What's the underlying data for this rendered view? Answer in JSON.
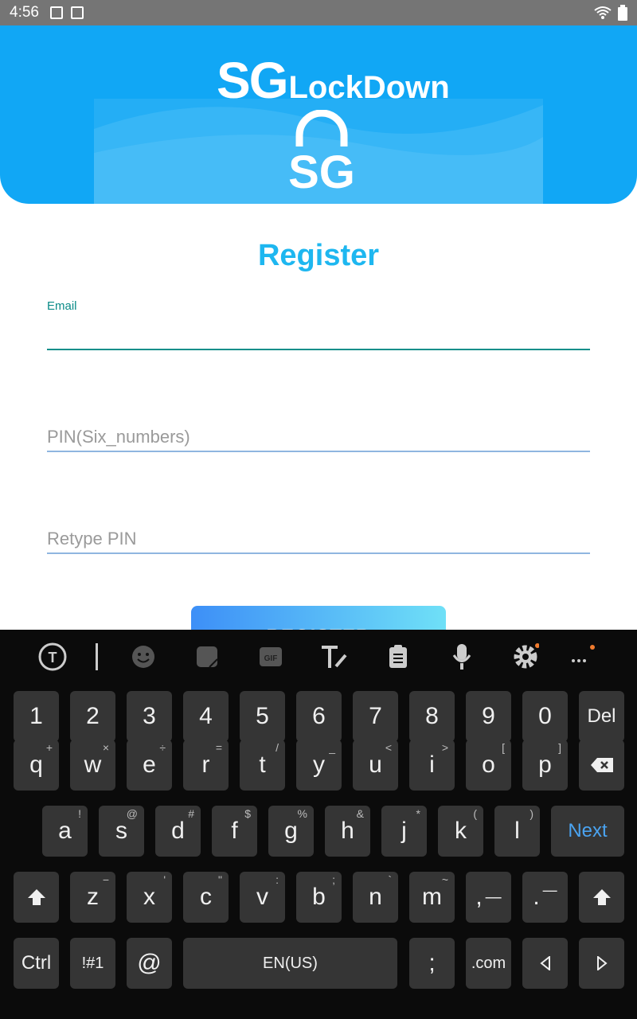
{
  "status_bar": {
    "time": "4:56"
  },
  "header": {
    "logo_sg": "SG",
    "logo_lockdown": "LockDown",
    "logo_icon_text": "SG"
  },
  "form": {
    "title": "Register",
    "email_label": "Email",
    "pin_placeholder": "PIN(Six_numbers)",
    "retype_placeholder": "Retype PIN",
    "register_label": "REGISTER"
  },
  "keyboard": {
    "row_numbers": [
      "1",
      "2",
      "3",
      "4",
      "5",
      "6",
      "7",
      "8",
      "9",
      "0"
    ],
    "del_label": "Del",
    "row_top": [
      {
        "k": "q",
        "s": "+"
      },
      {
        "k": "w",
        "s": "×"
      },
      {
        "k": "e",
        "s": "÷"
      },
      {
        "k": "r",
        "s": "="
      },
      {
        "k": "t",
        "s": "/"
      },
      {
        "k": "y",
        "s": "_"
      },
      {
        "k": "u",
        "s": "<"
      },
      {
        "k": "i",
        "s": ">"
      },
      {
        "k": "o",
        "s": "["
      },
      {
        "k": "p",
        "s": "]"
      }
    ],
    "row_mid": [
      {
        "k": "a",
        "s": "!"
      },
      {
        "k": "s",
        "s": "@"
      },
      {
        "k": "d",
        "s": "#"
      },
      {
        "k": "f",
        "s": "$"
      },
      {
        "k": "g",
        "s": "%"
      },
      {
        "k": "h",
        "s": "&"
      },
      {
        "k": "j",
        "s": "*"
      },
      {
        "k": "k",
        "s": "("
      },
      {
        "k": "l",
        "s": ")"
      }
    ],
    "next_label": "Next",
    "row_bottom": [
      {
        "k": "z",
        "s": "−"
      },
      {
        "k": "x",
        "s": "'"
      },
      {
        "k": "c",
        "s": "\""
      },
      {
        "k": "v",
        "s": ":"
      },
      {
        "k": "b",
        "s": ";"
      },
      {
        "k": "n",
        "s": "`"
      },
      {
        "k": "m",
        "s": "~"
      },
      {
        "k": ",",
        "s": ""
      },
      {
        "k": ".",
        "s": ""
      }
    ],
    "ctrl_label": "Ctrl",
    "symbols_label": "!#1",
    "at_label": "@",
    "space_label": "EN(US)",
    "semicolon_label": ";",
    "com_label": ".com"
  }
}
